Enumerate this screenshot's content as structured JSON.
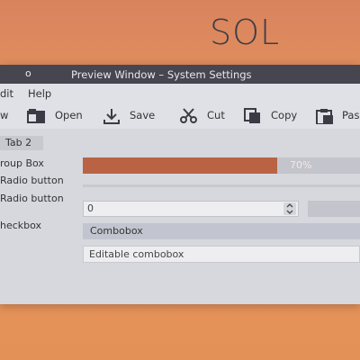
{
  "brand": {
    "text": "SOL"
  },
  "window": {
    "title": "Preview Window – System Settings",
    "title_button_glyph": "o"
  },
  "menubar": {
    "items": [
      "dit",
      "Help"
    ]
  },
  "toolbar": {
    "items": [
      {
        "label": "w",
        "icon": "new-icon"
      },
      {
        "label": "Open",
        "icon": "folder-icon"
      },
      {
        "label": "Save",
        "icon": "download-icon"
      },
      {
        "label": "Cut",
        "icon": "scissors-icon"
      },
      {
        "label": "Copy",
        "icon": "copy-icon"
      },
      {
        "label": "Pas",
        "icon": "paste-icon"
      }
    ]
  },
  "tabs": {
    "active": "Tab 2"
  },
  "labels": {
    "group_box": "roup Box",
    "radio1": "Radio button",
    "radio2": "Radio button",
    "checkbox": "heckbox"
  },
  "progress": {
    "value": 0.7,
    "text": "70%"
  },
  "spinbox": {
    "value": "0"
  },
  "combobox": {
    "value": "Combobox"
  },
  "editable_combobox": {
    "value": "Editable combobox"
  },
  "colors": {
    "titlebar": "#45464f",
    "window_bg": "#d7d8de",
    "progress_fill": "#b96344",
    "accent_background": "#e49157"
  }
}
